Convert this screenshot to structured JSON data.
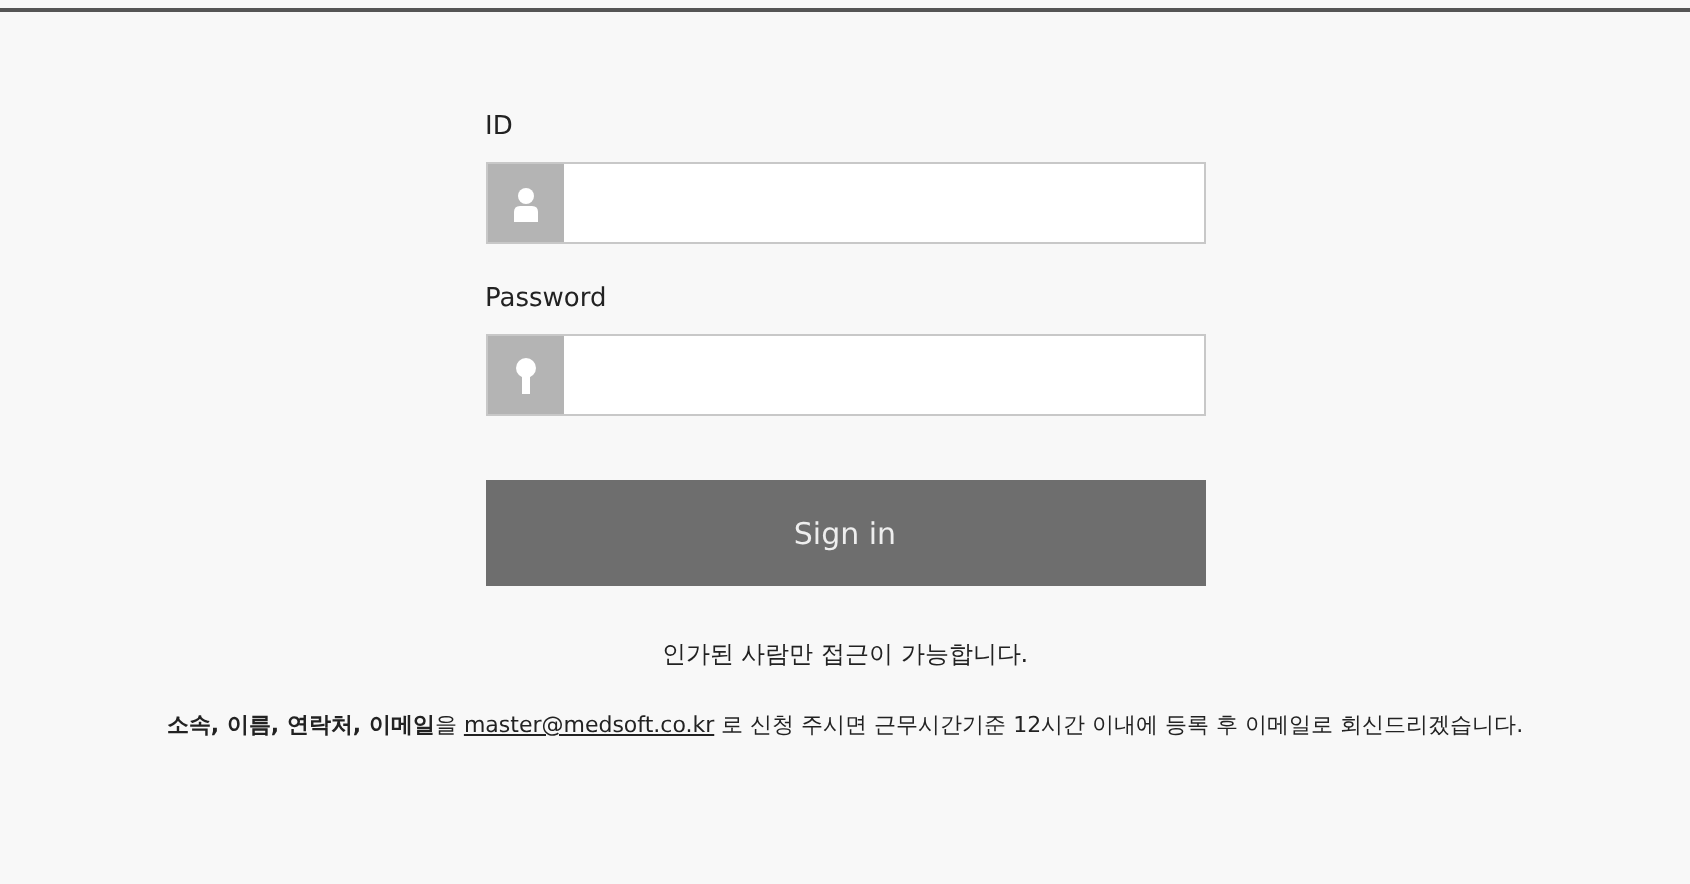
{
  "form": {
    "fields": [
      {
        "label": "ID",
        "kind": "user"
      },
      {
        "label": "Password",
        "kind": "password"
      }
    ],
    "submit": "Sign in"
  },
  "notice": "인가된 사람만 접근이 가능합니다.",
  "request": {
    "before": "**소속, 이름, 연락처, 이메일**을",
    "link": "master@medsoft.co.kr",
    "after": "로 신청 주시면 근무시간기준 12시간 이내에 등록 후 이메일로 회신드리겠습니다."
  }
}
